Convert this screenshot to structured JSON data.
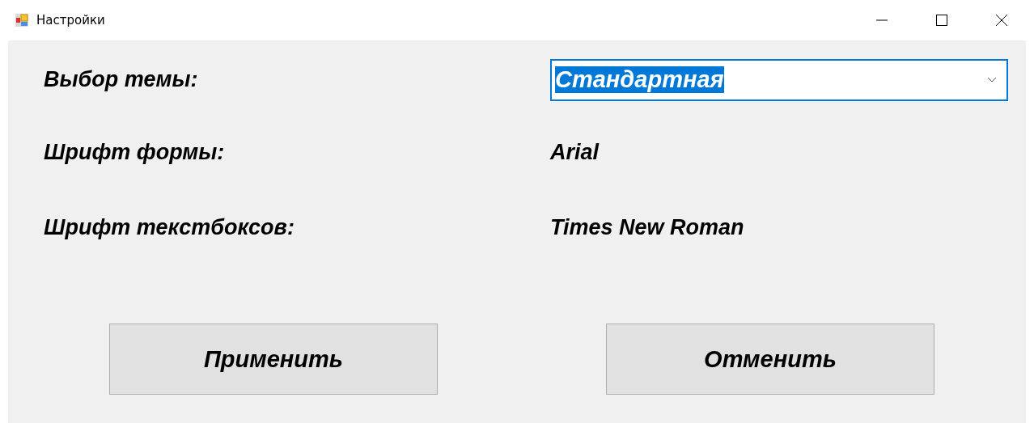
{
  "window": {
    "title": "Настройки"
  },
  "settings": [
    {
      "kind": "combo",
      "label": "Выбор темы:",
      "value": "Стандартная",
      "focused": true,
      "text_selected": true
    },
    {
      "kind": "text",
      "label": "Шрифт формы:",
      "value": "Arial"
    },
    {
      "kind": "text",
      "label": "Шрифт текстбоксов:",
      "value": "Times New Roman"
    }
  ],
  "buttons": [
    "Применить",
    "Отменить"
  ]
}
